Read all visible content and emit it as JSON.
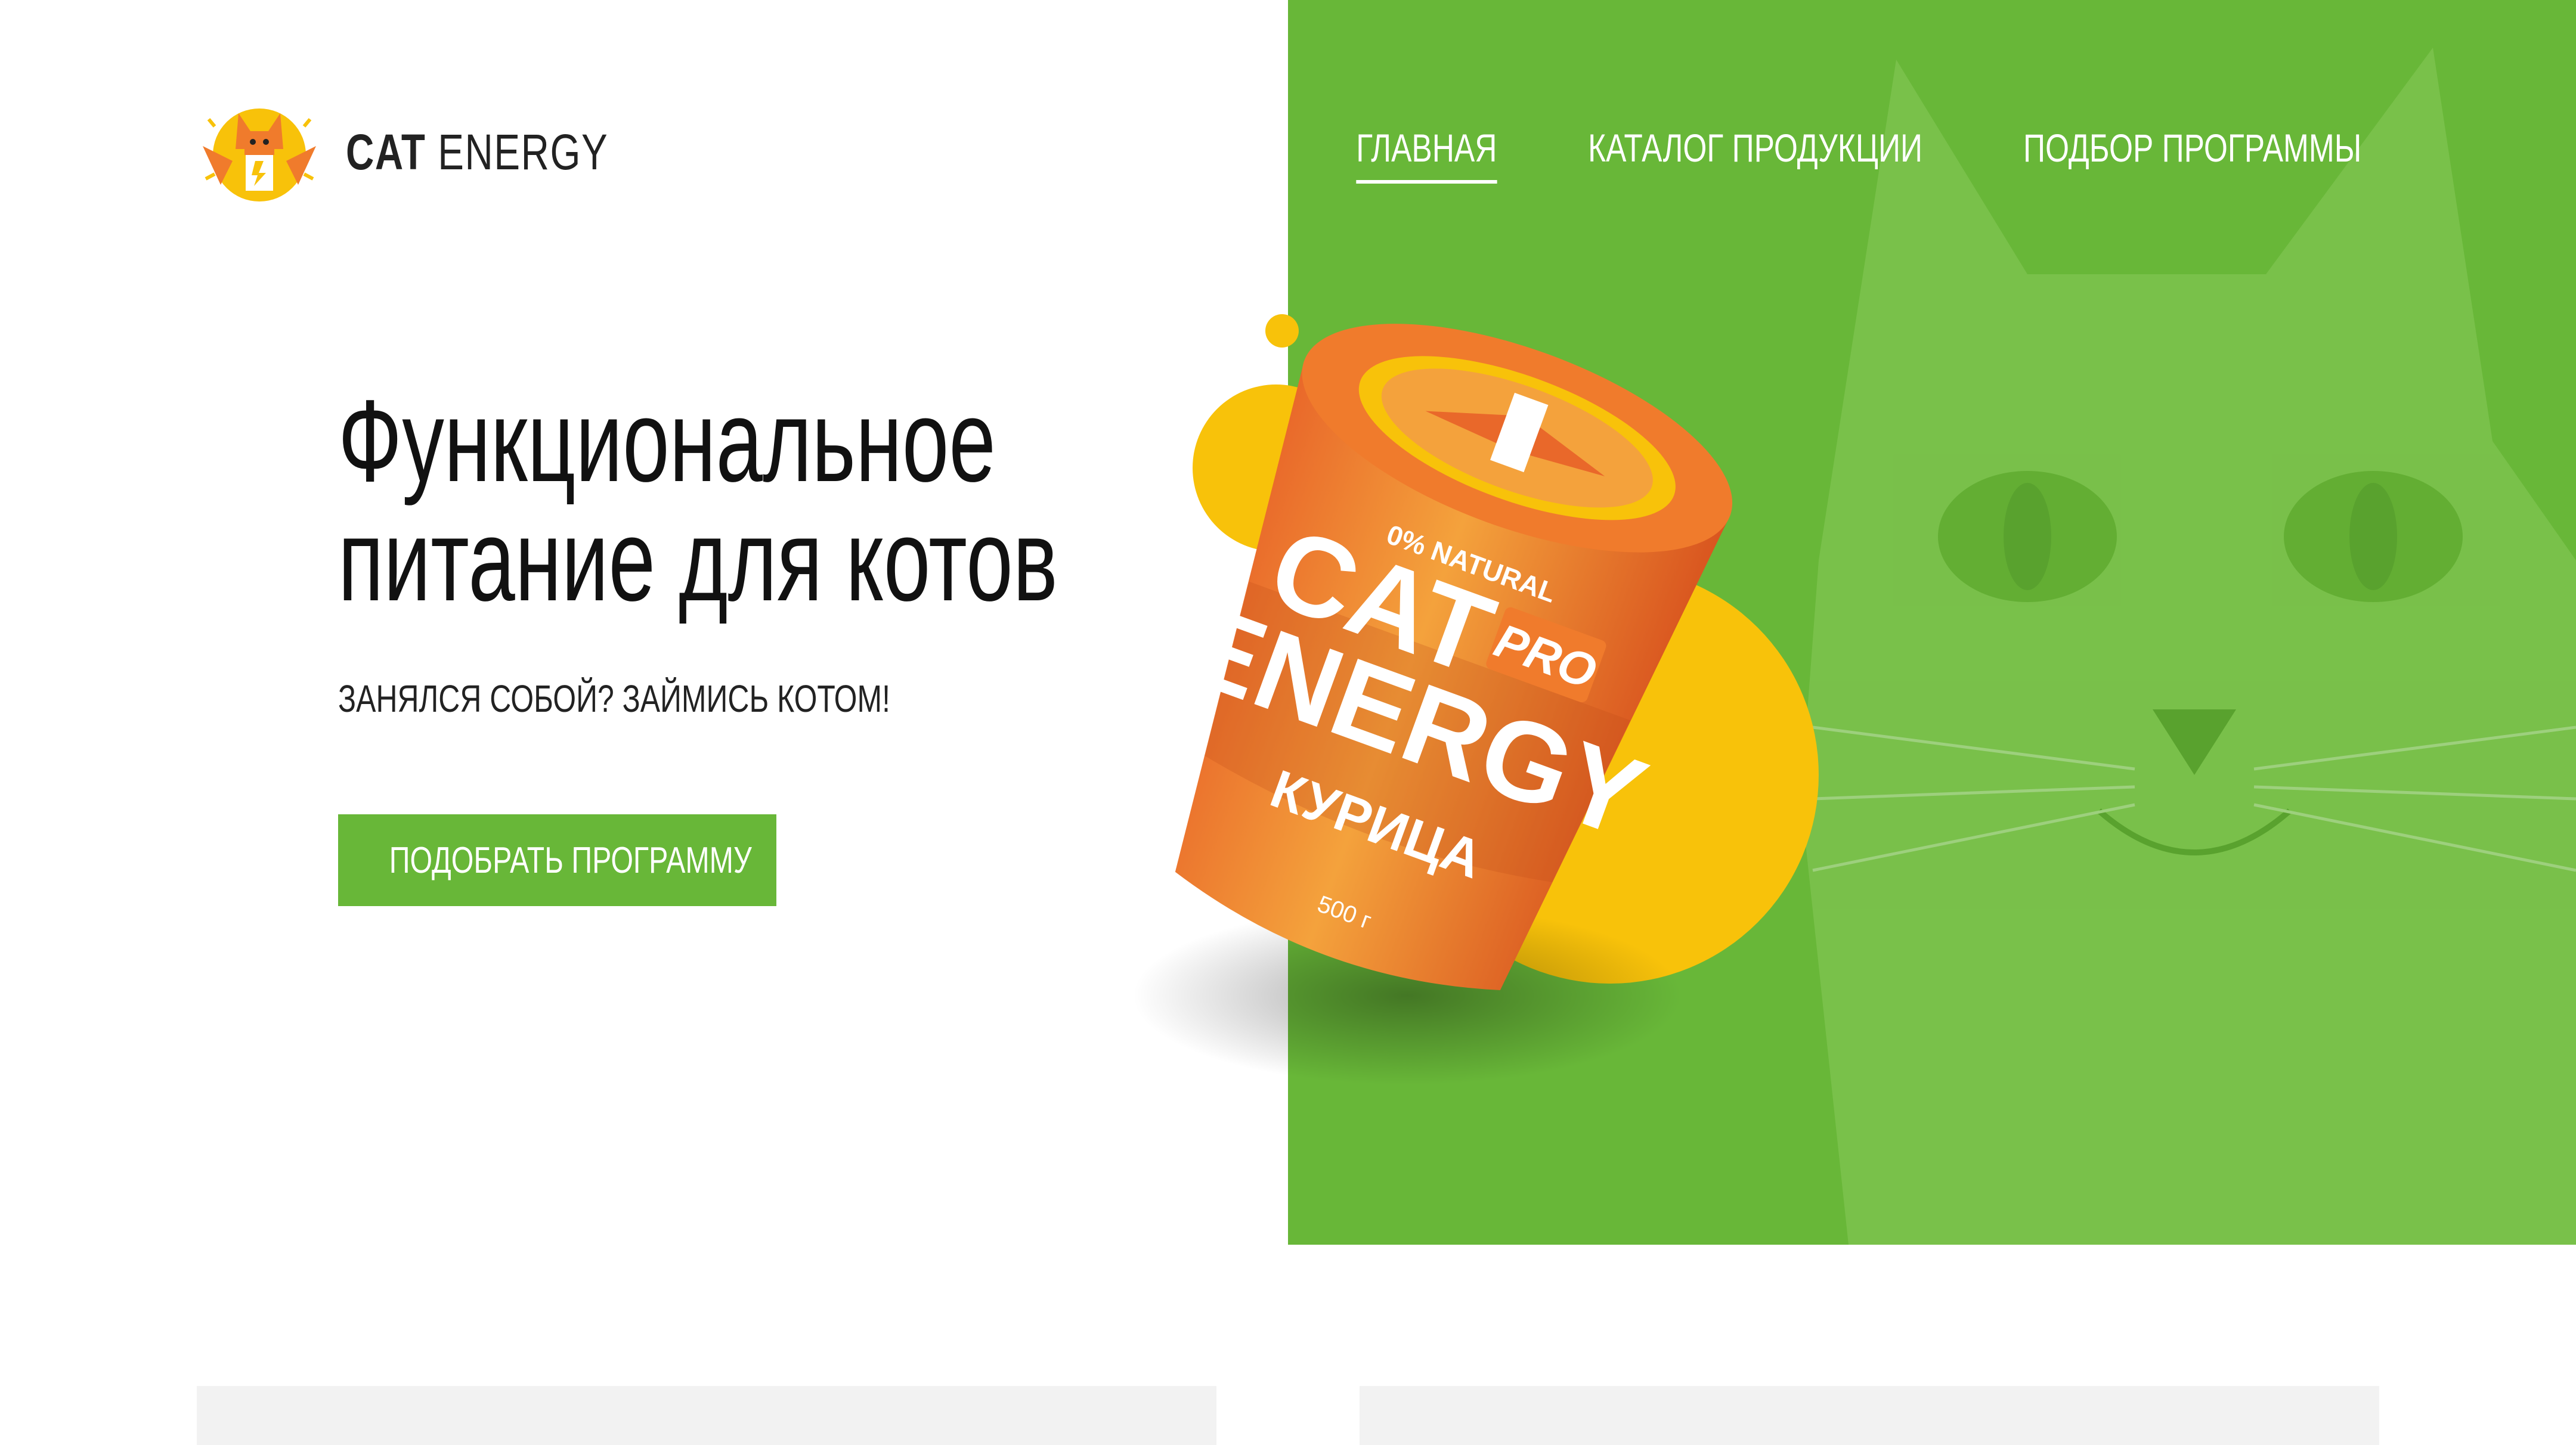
{
  "brand": {
    "name_bold": "CAT",
    "name_regular": "ENERGY",
    "logo_icon": "superhero-cat-icon"
  },
  "nav": {
    "items": [
      {
        "label": "ГЛАВНАЯ",
        "active": true
      },
      {
        "label": "КАТАЛОГ ПРОДУКЦИИ",
        "active": false
      },
      {
        "label": "ПОДБОР ПРОГРАММЫ",
        "active": false
      }
    ]
  },
  "hero": {
    "title_line1": "Функциональное",
    "title_line2": "питание для котов",
    "subtitle": "ЗАНЯЛСЯ СОБОЙ? ЗАЙМИСЬ КОТОМ!",
    "cta_label": "ПОДОБРАТЬ ПРОГРАММУ"
  },
  "product": {
    "natural_label": "0% NATURAL",
    "brand_line1": "CAT",
    "brand_line2": "ENERGY",
    "pro_badge": "PRO",
    "flavor": "КУРИЦА",
    "weight": "500 г"
  },
  "colors": {
    "accent_green": "#68b738",
    "accent_yellow": "#f8c20a",
    "accent_orange": "#f07b2c",
    "text_dark": "#111111",
    "card_bg": "#f2f2f2"
  }
}
